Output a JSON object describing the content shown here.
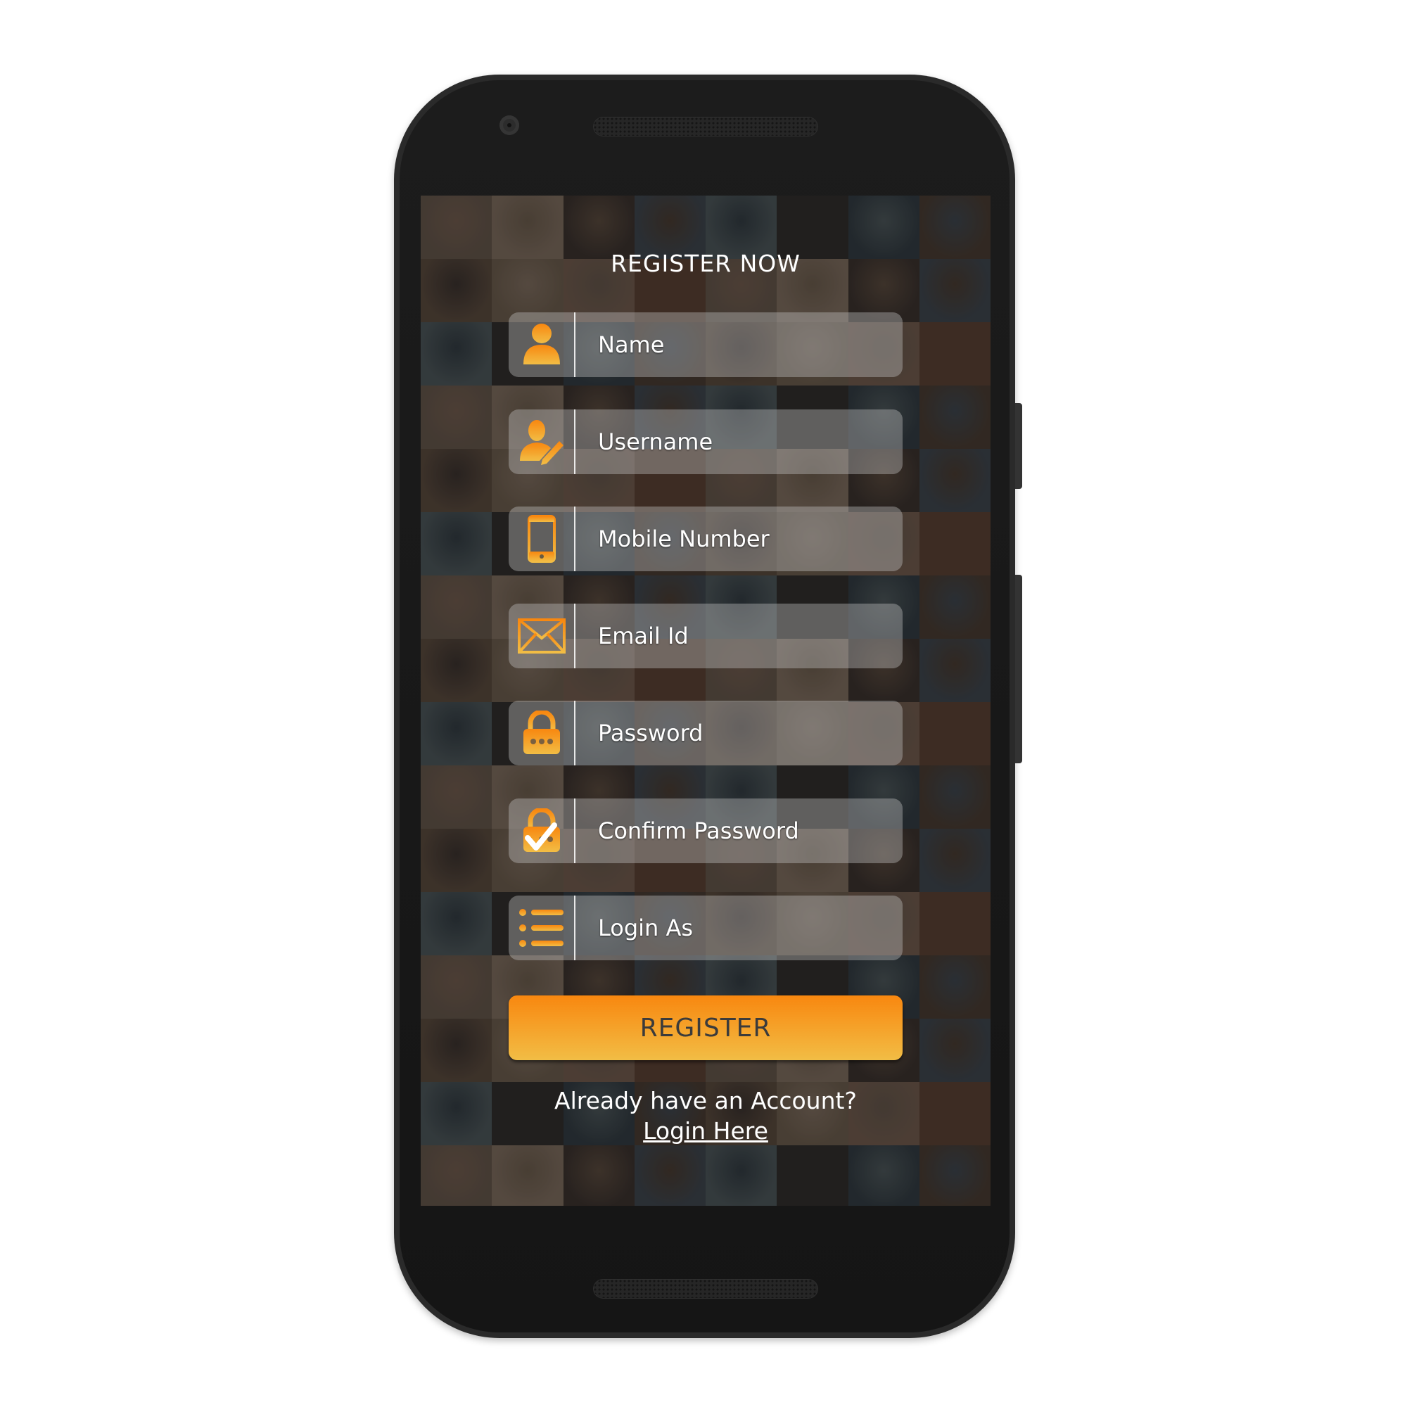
{
  "app": {
    "title": "REGISTER NOW"
  },
  "form": {
    "fields": [
      {
        "label": "Name",
        "icon": "person-icon"
      },
      {
        "label": "Username",
        "icon": "user-edit-icon"
      },
      {
        "label": "Mobile Number",
        "icon": "mobile-phone-icon"
      },
      {
        "label": "Email Id",
        "icon": "envelope-icon"
      },
      {
        "label": "Password",
        "icon": "lock-icon"
      },
      {
        "label": "Confirm Password",
        "icon": "lock-check-icon"
      },
      {
        "label": "Login As",
        "icon": "list-icon"
      }
    ],
    "submit_label": "REGISTER"
  },
  "footer": {
    "question": "Already have an Account?",
    "link_label": "Login Here"
  },
  "colors": {
    "accent_top": "#f8870f",
    "accent_bottom": "#f2bd45",
    "text": "#ffffff",
    "button_text": "#3b3b3b"
  }
}
